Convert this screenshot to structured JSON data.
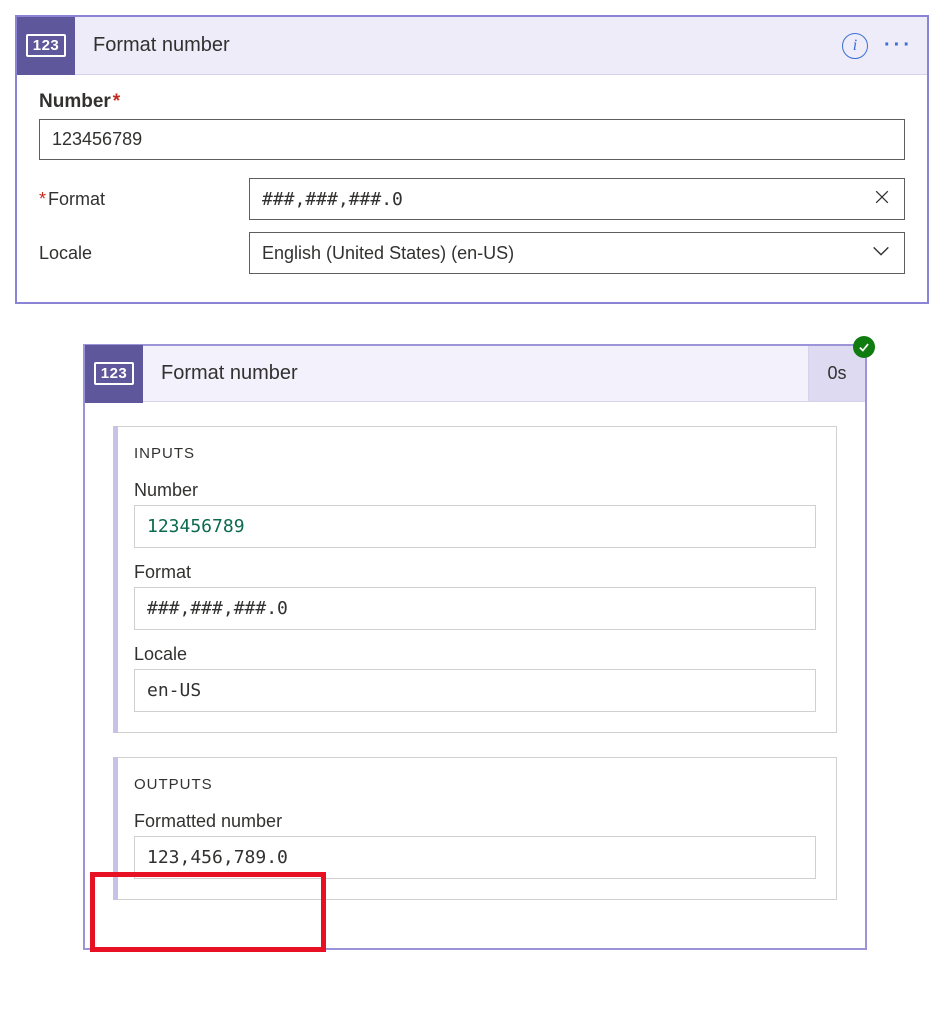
{
  "top": {
    "title": "Format number",
    "icon_text": "123",
    "number_label": "Number",
    "number_value": "123456789",
    "format_label": "Format",
    "format_value": "###,###,###.0",
    "locale_label": "Locale",
    "locale_value": "English (United States) (en-US)"
  },
  "bottom": {
    "title": "Format number",
    "icon_text": "123",
    "duration": "0s",
    "inputs": {
      "heading": "INPUTS",
      "number_label": "Number",
      "number_value": "123456789",
      "format_label": "Format",
      "format_value": "###,###,###.0",
      "locale_label": "Locale",
      "locale_value": "en-US"
    },
    "outputs": {
      "heading": "OUTPUTS",
      "formatted_label": "Formatted number",
      "formatted_value": "123,456,789.0"
    }
  }
}
